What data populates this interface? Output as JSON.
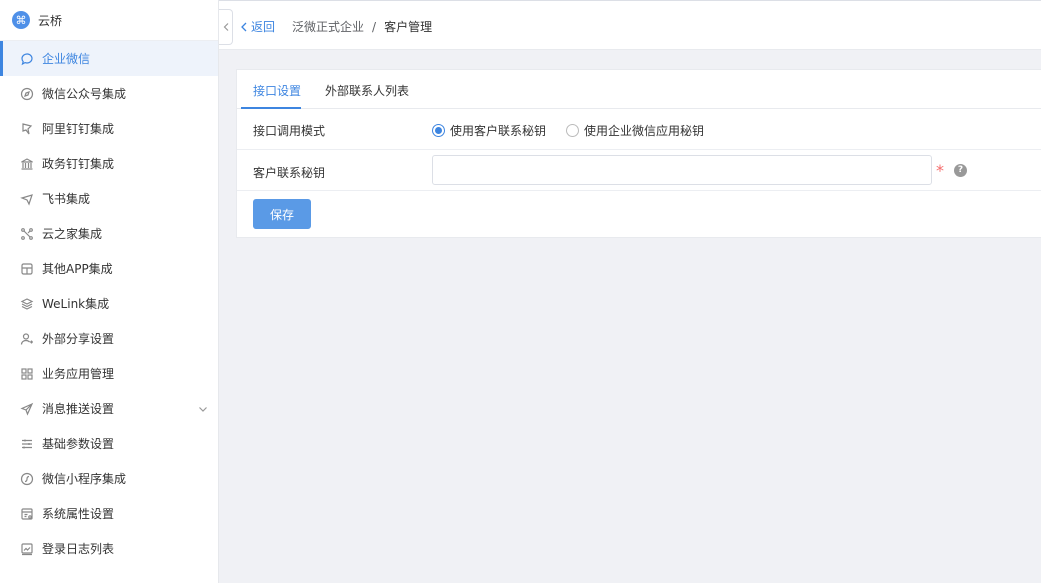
{
  "app": {
    "name": "云桥",
    "logo_glyph": "⌘",
    "accent_color": "#3d85e0"
  },
  "sidebar": {
    "items": [
      {
        "label": "企业微信",
        "icon": "chat-icon",
        "active": true
      },
      {
        "label": "微信公众号集成",
        "icon": "compass-icon"
      },
      {
        "label": "阿里钉钉集成",
        "icon": "pin-icon"
      },
      {
        "label": "政务钉钉集成",
        "icon": "bank-icon"
      },
      {
        "label": "飞书集成",
        "icon": "plane-icon"
      },
      {
        "label": "云之家集成",
        "icon": "nodes-icon"
      },
      {
        "label": "其他APP集成",
        "icon": "app-icon"
      },
      {
        "label": "WeLink集成",
        "icon": "layers-icon"
      },
      {
        "label": "外部分享设置",
        "icon": "user-icon"
      },
      {
        "label": "业务应用管理",
        "icon": "grid-icon"
      },
      {
        "label": "消息推送设置",
        "icon": "send-icon",
        "expandable": true
      },
      {
        "label": "基础参数设置",
        "icon": "sliders-icon"
      },
      {
        "label": "微信小程序集成",
        "icon": "miniprogram-icon"
      },
      {
        "label": "系统属性设置",
        "icon": "settings-panel-icon"
      },
      {
        "label": "登录日志列表",
        "icon": "log-icon"
      }
    ]
  },
  "header": {
    "back_label": "返回",
    "breadcrumb": [
      "泛微正式企业",
      "客户管理"
    ],
    "breadcrumb_separator": "/"
  },
  "tabs": [
    {
      "label": "接口设置",
      "active": true
    },
    {
      "label": "外部联系人列表",
      "active": false
    }
  ],
  "form": {
    "mode": {
      "label": "接口调用模式",
      "options": [
        {
          "label": "使用客户联系秘钥",
          "checked": true
        },
        {
          "label": "使用企业微信应用秘钥",
          "checked": false
        }
      ]
    },
    "secret": {
      "label": "客户联系秘钥",
      "value": "",
      "required_mark": "*",
      "help_glyph": "?"
    },
    "save_label": "保存"
  }
}
